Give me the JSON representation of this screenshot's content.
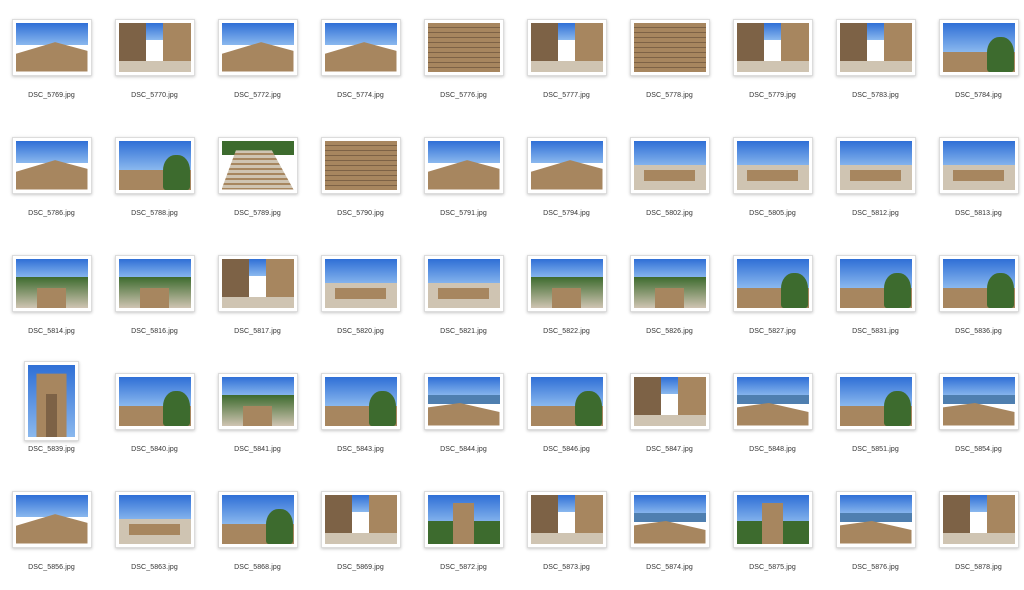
{
  "window": {
    "view": "icon-grid"
  },
  "colors": {
    "sky_top": "#2f6fd6",
    "sky_bottom": "#8ab8ee",
    "stone": "#a7865f",
    "stone_dark": "#7d6246",
    "ground": "#cfc4b2",
    "tree": "#3d6b2e",
    "sea": "#4f7fb0",
    "label_text": "#333333"
  },
  "files": [
    {
      "name": "DSC_5769.jpg",
      "orient": "landscape",
      "scene": "wall-sky"
    },
    {
      "name": "DSC_5770.jpg",
      "orient": "landscape",
      "scene": "walls"
    },
    {
      "name": "DSC_5772.jpg",
      "orient": "landscape",
      "scene": "wall-sky"
    },
    {
      "name": "DSC_5774.jpg",
      "orient": "landscape",
      "scene": "wall-sky"
    },
    {
      "name": "DSC_5776.jpg",
      "orient": "landscape",
      "scene": "stone"
    },
    {
      "name": "DSC_5777.jpg",
      "orient": "landscape",
      "scene": "walls"
    },
    {
      "name": "DSC_5778.jpg",
      "orient": "landscape",
      "scene": "stone"
    },
    {
      "name": "DSC_5779.jpg",
      "orient": "landscape",
      "scene": "walls"
    },
    {
      "name": "DSC_5783.jpg",
      "orient": "landscape",
      "scene": "walls"
    },
    {
      "name": "DSC_5784.jpg",
      "orient": "landscape",
      "scene": "trees"
    },
    {
      "name": "DSC_5786.jpg",
      "orient": "landscape",
      "scene": "wall-sky"
    },
    {
      "name": "DSC_5788.jpg",
      "orient": "landscape",
      "scene": "trees"
    },
    {
      "name": "DSC_5789.jpg",
      "orient": "landscape",
      "scene": "stairs"
    },
    {
      "name": "DSC_5790.jpg",
      "orient": "landscape",
      "scene": "stone"
    },
    {
      "name": "DSC_5791.jpg",
      "orient": "landscape",
      "scene": "wall-sky"
    },
    {
      "name": "DSC_5794.jpg",
      "orient": "landscape",
      "scene": "wall-sky"
    },
    {
      "name": "DSC_5802.jpg",
      "orient": "landscape",
      "scene": "panorama"
    },
    {
      "name": "DSC_5805.jpg",
      "orient": "landscape",
      "scene": "panorama"
    },
    {
      "name": "DSC_5812.jpg",
      "orient": "landscape",
      "scene": "panorama"
    },
    {
      "name": "DSC_5813.jpg",
      "orient": "landscape",
      "scene": "panorama"
    },
    {
      "name": "DSC_5814.jpg",
      "orient": "landscape",
      "scene": "city"
    },
    {
      "name": "DSC_5816.jpg",
      "orient": "landscape",
      "scene": "city"
    },
    {
      "name": "DSC_5817.jpg",
      "orient": "landscape",
      "scene": "walls"
    },
    {
      "name": "DSC_5820.jpg",
      "orient": "landscape",
      "scene": "panorama"
    },
    {
      "name": "DSC_5821.jpg",
      "orient": "landscape",
      "scene": "panorama"
    },
    {
      "name": "DSC_5822.jpg",
      "orient": "landscape",
      "scene": "city"
    },
    {
      "name": "DSC_5826.jpg",
      "orient": "landscape",
      "scene": "city"
    },
    {
      "name": "DSC_5827.jpg",
      "orient": "landscape",
      "scene": "trees"
    },
    {
      "name": "DSC_5831.jpg",
      "orient": "landscape",
      "scene": "trees"
    },
    {
      "name": "DSC_5836.jpg",
      "orient": "landscape",
      "scene": "trees"
    },
    {
      "name": "DSC_5839.jpg",
      "orient": "portrait",
      "scene": "tower"
    },
    {
      "name": "DSC_5840.jpg",
      "orient": "landscape",
      "scene": "trees"
    },
    {
      "name": "DSC_5841.jpg",
      "orient": "landscape",
      "scene": "city"
    },
    {
      "name": "DSC_5843.jpg",
      "orient": "landscape",
      "scene": "trees"
    },
    {
      "name": "DSC_5844.jpg",
      "orient": "landscape",
      "scene": "sea"
    },
    {
      "name": "DSC_5846.jpg",
      "orient": "landscape",
      "scene": "trees"
    },
    {
      "name": "DSC_5847.jpg",
      "orient": "landscape",
      "scene": "walls"
    },
    {
      "name": "DSC_5848.jpg",
      "orient": "landscape",
      "scene": "sea"
    },
    {
      "name": "DSC_5851.jpg",
      "orient": "landscape",
      "scene": "trees"
    },
    {
      "name": "DSC_5854.jpg",
      "orient": "landscape",
      "scene": "sea"
    },
    {
      "name": "DSC_5856.jpg",
      "orient": "landscape",
      "scene": "wall-sky"
    },
    {
      "name": "DSC_5863.jpg",
      "orient": "landscape",
      "scene": "panorama"
    },
    {
      "name": "DSC_5868.jpg",
      "orient": "landscape",
      "scene": "trees"
    },
    {
      "name": "DSC_5869.jpg",
      "orient": "landscape",
      "scene": "walls"
    },
    {
      "name": "DSC_5872.jpg",
      "orient": "landscape",
      "scene": "tower-sky"
    },
    {
      "name": "DSC_5873.jpg",
      "orient": "landscape",
      "scene": "walls"
    },
    {
      "name": "DSC_5874.jpg",
      "orient": "landscape",
      "scene": "sea"
    },
    {
      "name": "DSC_5875.jpg",
      "orient": "landscape",
      "scene": "tower-sky"
    },
    {
      "name": "DSC_5876.jpg",
      "orient": "landscape",
      "scene": "sea"
    },
    {
      "name": "DSC_5878.jpg",
      "orient": "landscape",
      "scene": "walls"
    }
  ]
}
